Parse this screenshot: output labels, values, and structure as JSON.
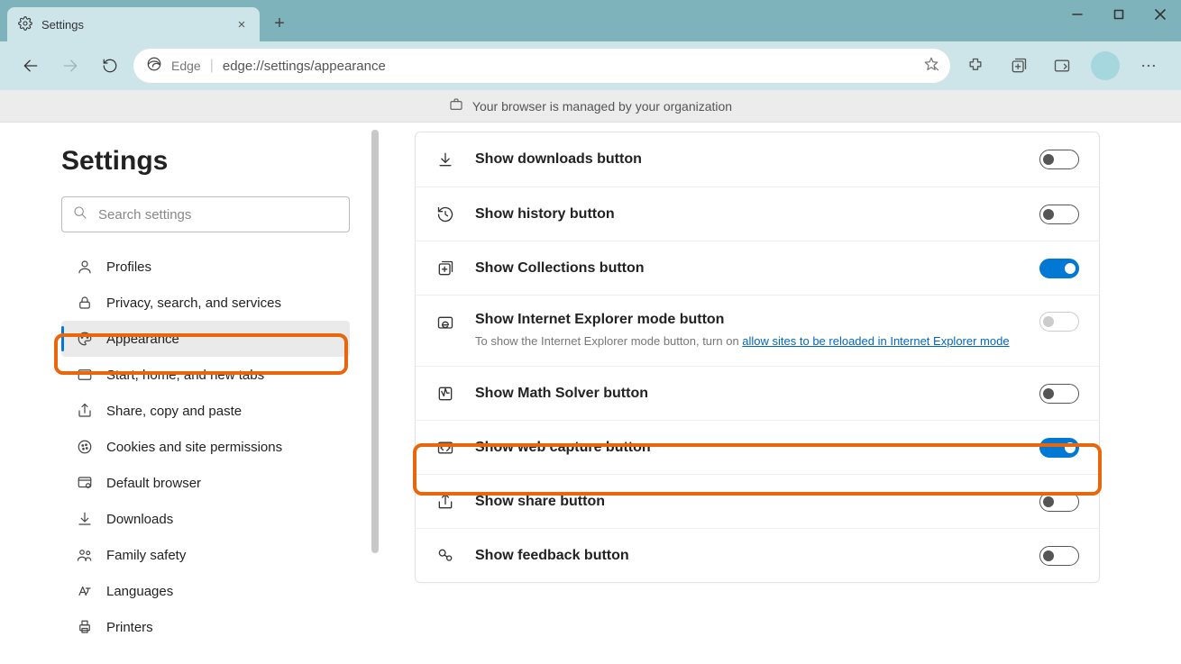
{
  "tab": {
    "title": "Settings"
  },
  "address": {
    "browser_label": "Edge",
    "url": "edge://settings/appearance"
  },
  "banner": {
    "text": "Your browser is managed by your organization"
  },
  "sidebar": {
    "title": "Settings",
    "search_placeholder": "Search settings",
    "items": [
      {
        "label": "Profiles"
      },
      {
        "label": "Privacy, search, and services"
      },
      {
        "label": "Appearance"
      },
      {
        "label": "Start, home, and new tabs"
      },
      {
        "label": "Share, copy and paste"
      },
      {
        "label": "Cookies and site permissions"
      },
      {
        "label": "Default browser"
      },
      {
        "label": "Downloads"
      },
      {
        "label": "Family safety"
      },
      {
        "label": "Languages"
      },
      {
        "label": "Printers"
      }
    ]
  },
  "settings": [
    {
      "title": "Show downloads button",
      "state": "off"
    },
    {
      "title": "Show history button",
      "state": "off"
    },
    {
      "title": "Show Collections button",
      "state": "on"
    },
    {
      "title": "Show Internet Explorer mode button",
      "sub_prefix": "To show the Internet Explorer mode button, turn on ",
      "sub_link": "allow sites to be reloaded in Internet Explorer mode",
      "state": "disabled"
    },
    {
      "title": "Show Math Solver button",
      "state": "off"
    },
    {
      "title": "Show web capture button",
      "state": "on"
    },
    {
      "title": "Show share button",
      "state": "off"
    },
    {
      "title": "Show feedback button",
      "state": "off"
    }
  ]
}
